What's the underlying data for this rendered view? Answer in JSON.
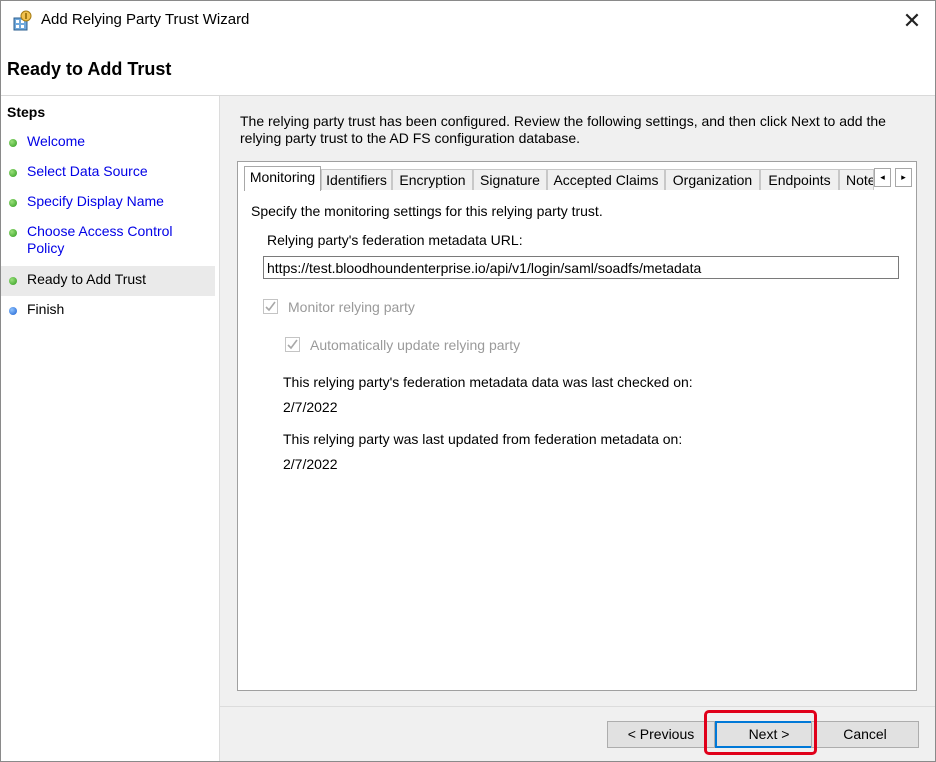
{
  "window": {
    "title": "Add Relying Party Trust Wizard",
    "close_glyph": "✕"
  },
  "header": {
    "page_title": "Ready to Add Trust"
  },
  "steps": {
    "title": "Steps",
    "items": [
      {
        "label": "Welcome",
        "status": "done"
      },
      {
        "label": "Select Data Source",
        "status": "done"
      },
      {
        "label": "Specify Display Name",
        "status": "done"
      },
      {
        "label_line1": "Choose Access Control",
        "label_line2": "Policy",
        "status": "done"
      },
      {
        "label": "Ready to Add Trust",
        "status": "current"
      },
      {
        "label": "Finish",
        "status": "pending"
      }
    ]
  },
  "main": {
    "description_line1": "The relying party trust has been configured. Review the following settings, and then click Next to add the",
    "description_line2": "relying party trust to the AD FS configuration database.",
    "tabs": [
      {
        "label": "Monitoring",
        "active": true
      },
      {
        "label": "Identifiers"
      },
      {
        "label": "Encryption"
      },
      {
        "label": "Signature"
      },
      {
        "label": "Accepted Claims"
      },
      {
        "label": "Organization"
      },
      {
        "label": "Endpoints"
      },
      {
        "label": "Note"
      }
    ],
    "tab_scroll_left": "◂",
    "tab_scroll_right": "▸",
    "monitoring": {
      "intro": "Specify the monitoring settings for this relying party trust.",
      "url_label": "Relying party's federation metadata URL:",
      "url_value": "https://test.bloodhoundenterprise.io/api/v1/login/saml/soadfs/metadata",
      "monitor_label": "Monitor relying party",
      "monitor_checked": true,
      "auto_update_label": "Automatically update relying party",
      "auto_update_checked": true,
      "last_checked_label": "This relying party's federation metadata data was last checked on:",
      "last_checked_value": "2/7/2022",
      "last_updated_label": "This relying party was last updated from federation metadata on:",
      "last_updated_value": "2/7/2022"
    }
  },
  "footer": {
    "previous_label": "< Previous",
    "next_label": "Next >",
    "cancel_label": "Cancel"
  },
  "colors": {
    "link": "#0000e6",
    "highlight": "#e0001a",
    "primary_border": "#0078d7",
    "step_done": "#2f9b1e",
    "step_pending": "#1a5fd0"
  }
}
